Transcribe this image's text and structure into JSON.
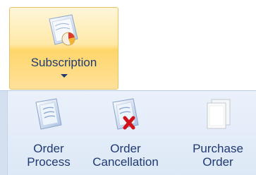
{
  "ribbon": {
    "subscription_button": {
      "label": "Subscription",
      "icon": "subscription-icon"
    }
  },
  "dropdown": {
    "items": [
      {
        "line1": "Order",
        "line2": "Process",
        "icon": "order-process-icon"
      },
      {
        "line1": "Order",
        "line2": "Cancellation",
        "icon": "order-cancellation-icon"
      },
      {
        "line1": "Purchase",
        "line2": "Order",
        "icon": "purchase-order-icon"
      }
    ]
  },
  "colors": {
    "label_text": "#1f3a73",
    "highlight": "#ffd66b",
    "panel_bg": "#e3ecf8",
    "cancel_mark": "#d0121a"
  }
}
